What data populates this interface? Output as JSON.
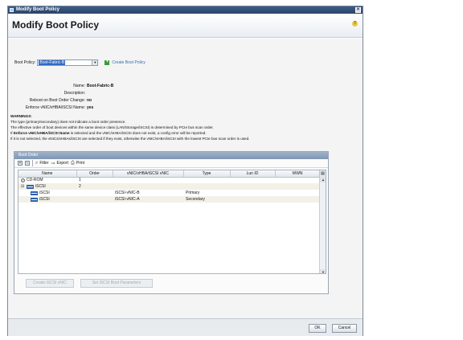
{
  "window": {
    "title": "Modify Boot Policy"
  },
  "header": {
    "title": "Modify Boot Policy",
    "help_glyph": "?"
  },
  "boot_policy": {
    "label": "Boot Policy:",
    "selected": "Boot-Fabric-B",
    "create_link": "Create Boot Policy"
  },
  "properties": [
    {
      "key": "Name:",
      "value": "Boot-Fabric-B"
    },
    {
      "key": "Description:",
      "value": ""
    },
    {
      "key": "Reboot on Boot Order Change:",
      "value": "no"
    },
    {
      "key": "Enforce vNIC/vHBA/iSCSI Name:",
      "value": "yes"
    }
  ],
  "warnings": {
    "title": "WARNINGS:",
    "line1": "The type (primary/secondary) does not indicate a boot order presence.",
    "line2": "The effective order of boot devices within the same device class (LAN/Storage/iSCSI) is determined by PCIe bus scan order.",
    "line3_pre": "If ",
    "line3_bold": "Enforce vNIC/vHBA/iSCSI Name",
    "line3_post": " is selected and the vNIC/vHBA/iSCSI does not exist, a config error will be reported.",
    "line4": "If it is not selected, the vNICs/vHBAs/iSCSI are selected if they exist, otherwise the vNIC/vHBA/iSCSI with the lowest PCIe bus scan order is used."
  },
  "boot_order": {
    "panel_title": "Boot Order",
    "toolbar": {
      "filter": "Filter",
      "export": "Export",
      "print": "Print"
    },
    "columns": [
      "Name",
      "Order",
      "vNIC/vHBA/iSCSI vNIC",
      "Type",
      "Lun ID",
      "WWN"
    ],
    "rows": [
      {
        "name": "CD-ROM",
        "order": "1",
        "vnic": "",
        "type": "",
        "lun": "",
        "wwn": ""
      },
      {
        "name": "iSCSI",
        "order": "2",
        "vnic": "",
        "type": "",
        "lun": "",
        "wwn": ""
      },
      {
        "name": "iSCSI",
        "order": "",
        "vnic": "iSCSI-vNIC-B",
        "type": "Primary",
        "lun": "",
        "wwn": ""
      },
      {
        "name": "iSCSI",
        "order": "",
        "vnic": "iSCSI-vNIC-A",
        "type": "Secondary",
        "lun": "",
        "wwn": ""
      }
    ],
    "buttons": {
      "create_iscsi": "Create iSCSI vNIC",
      "set_iscsi": "Set iSCSI Boot Parameters"
    }
  },
  "footer": {
    "ok": "OK",
    "cancel": "Cancel"
  },
  "colors": {
    "title_bar": "#2f4c75",
    "link": "#2e6db4",
    "selection": "#3169c6"
  }
}
